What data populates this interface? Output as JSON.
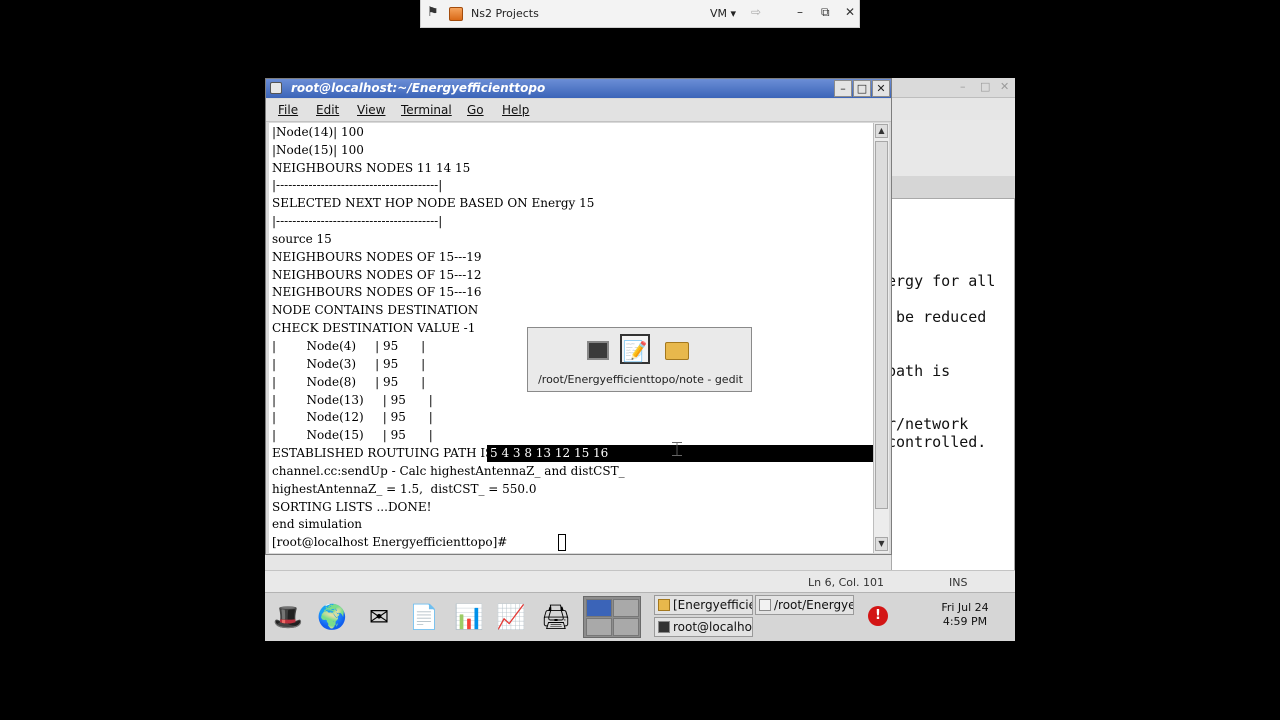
{
  "viewer": {
    "title": "Ns2 Projects",
    "vm_label": "VM",
    "pin_glyph": "⚑",
    "dropdown_glyph": "▾",
    "forward_glyph": "⇨",
    "minimize_glyph": "–",
    "restore_glyph": "⧉",
    "close_glyph": "✕"
  },
  "terminal": {
    "title": "root@localhost:~/Energyefficienttopo",
    "menu": [
      "File",
      "Edit",
      "View",
      "Terminal",
      "Go",
      "Help"
    ],
    "lines": [
      "|Node(14)| 100",
      "|Node(15)| 100",
      "NEIGHBOURS NODES 11 14 15",
      "|----------------------------------------|",
      "SELECTED NEXT HOP NODE BASED ON Energy 15",
      "|----------------------------------------|",
      "source 15",
      "NEIGHBOURS NODES OF 15---19",
      "NEIGHBOURS NODES OF 15---12",
      "NEIGHBOURS NODES OF 15---16",
      "NODE CONTAINS DESTINATION",
      "CHECK DESTINATION VALUE -1",
      "|        Node(4)     | 95      |",
      "|        Node(3)     | 95      |",
      "|        Node(8)     | 95      |",
      "|        Node(13)     | 95      |",
      "|        Node(12)     | 95      |",
      "|        Node(15)     | 95      |",
      "ESTABLISHED ROUTUING PATH IS",
      "channel.cc:sendUp - Calc highestAntennaZ_ and distCST_",
      "highestAntennaZ_ = 1.5,  distCST_ = 550.0",
      "SORTING LISTS ...DONE!",
      "end simulation",
      "[root@localhost Energyefficienttopo]#"
    ],
    "selected_path": "5 4 3 8 13 12 15 16",
    "window_buttons": {
      "minimize": "–",
      "maximize": "□",
      "close": "✕"
    },
    "scroll_up": "▲",
    "scroll_down": "▼"
  },
  "gedit": {
    "doc_lines": [
      "ergy for all",
      "be reduced",
      "path is",
      "r/network",
      "controlled."
    ],
    "status_position": "Ln 6, Col. 101",
    "status_mode": "INS",
    "title_buttons": {
      "minimize": "–",
      "maximize": "□",
      "close": "✕"
    }
  },
  "switcher": {
    "caption": "/root/Energyefficienttopo/note - gedit",
    "icons": [
      "terminal-icon",
      "gedit-note-icon",
      "folder-icon"
    ]
  },
  "panel": {
    "launchers": [
      "redhat-menu-icon",
      "web-browser-icon",
      "email-icon",
      "writer-icon",
      "calc-icon",
      "impress-icon",
      "print-manager-icon"
    ],
    "tasks": [
      {
        "label": "[Energyefficier",
        "icon": "folder-icon"
      },
      {
        "label": "/root/Energyeff",
        "icon": "gedit-icon"
      },
      {
        "label": "root@localhost",
        "icon": "terminal-icon"
      }
    ],
    "clock_date": "Fri Jul 24",
    "clock_time": "4:59 PM",
    "alert_glyph": "!"
  }
}
